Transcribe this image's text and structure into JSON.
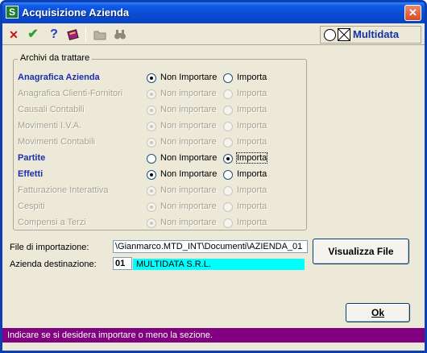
{
  "window": {
    "title": "Acquisizione Azienda",
    "close_label": "✕",
    "app_icon_letter": "S"
  },
  "toolbar": {
    "icons": [
      "cancel-icon",
      "confirm-icon",
      "help-icon",
      "book-icon",
      "folder-icon",
      "binoculars-icon"
    ],
    "brand_name": "Multidata"
  },
  "archivi": {
    "legend": "Archivi da trattare",
    "option_no_active": "Non Importare",
    "option_no_disabled": "Non importare",
    "option_yes": "Importa",
    "rows": [
      {
        "label": "Anagrafica Azienda",
        "enabled": true,
        "selected": "no"
      },
      {
        "label": "Anagrafica Clienti-Fornitori",
        "enabled": false,
        "selected": "no"
      },
      {
        "label": "Causali Contabili",
        "enabled": false,
        "selected": "no"
      },
      {
        "label": "Movimenti I.V.A.",
        "enabled": false,
        "selected": "no"
      },
      {
        "label": "Movimenti Contabili",
        "enabled": false,
        "selected": "no"
      },
      {
        "label": "Partite",
        "enabled": true,
        "selected": "yes"
      },
      {
        "label": "Effetti",
        "enabled": true,
        "selected": "no"
      },
      {
        "label": "Fatturazione Interattiva",
        "enabled": false,
        "selected": "no"
      },
      {
        "label": "Cespiti",
        "enabled": false,
        "selected": "no"
      },
      {
        "label": "Compensi a Terzi",
        "enabled": false,
        "selected": "no"
      }
    ]
  },
  "form": {
    "file_label": "File di importazione:",
    "file_value": "\\Gianmarco.MTD_INT\\Documenti\\AZIENDA_01",
    "azienda_label": "Azienda destinazione:",
    "azienda_code": "01",
    "azienda_name": "MULTIDATA S.R.L."
  },
  "buttons": {
    "visualizza": "Visualizza File",
    "ok": "Ok"
  },
  "status": {
    "text": "Indicare se si desidera importare o meno la sezione."
  }
}
